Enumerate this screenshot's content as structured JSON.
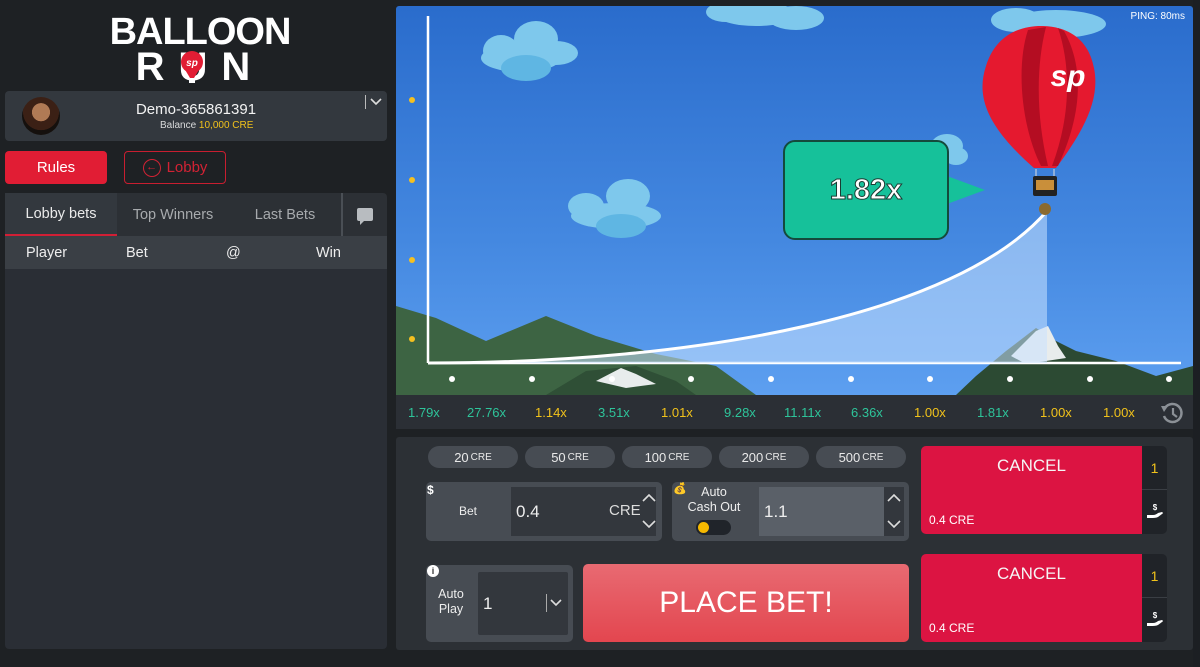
{
  "app": {
    "logo_line1": "BALLOON",
    "logo_line2": "RUN",
    "logo_badge": "sp"
  },
  "user": {
    "name": "Demo-365861391",
    "balance_label": "Balance",
    "balance_value": "10,000 CRE",
    "avatar_icon": "avatar-bearded-man"
  },
  "nav": {
    "rules_label": "Rules",
    "lobby_label": "Lobby",
    "lobby_icon": "arrow-left-circle-icon"
  },
  "sidebar": {
    "tabs": [
      {
        "label": "Lobby bets",
        "active": true
      },
      {
        "label": "Top Winners",
        "active": false
      },
      {
        "label": "Last Bets",
        "active": false
      }
    ],
    "chat_icon": "chat-bubble-icon",
    "columns": [
      "Player",
      "Bet",
      "@",
      "Win"
    ],
    "rows": []
  },
  "game": {
    "ping": "PING: 80ms",
    "multiplier": "1.82x",
    "balloon_logo": "sp"
  },
  "history": {
    "items": [
      {
        "value": "1.79x",
        "color": "#2ec49a"
      },
      {
        "value": "27.76x",
        "color": "#2ec49a"
      },
      {
        "value": "1.14x",
        "color": "#f1c21b"
      },
      {
        "value": "3.51x",
        "color": "#2ec49a"
      },
      {
        "value": "1.01x",
        "color": "#f1c21b"
      },
      {
        "value": "9.28x",
        "color": "#2ec49a"
      },
      {
        "value": "11.11x",
        "color": "#2ec49a"
      },
      {
        "value": "6.36x",
        "color": "#2ec49a"
      },
      {
        "value": "1.00x",
        "color": "#f1c21b"
      },
      {
        "value": "1.81x",
        "color": "#2ec49a"
      },
      {
        "value": "1.00x",
        "color": "#f1c21b"
      },
      {
        "value": "1.00x",
        "color": "#f1c21b"
      }
    ],
    "history_icon": "history-clock-icon"
  },
  "controls": {
    "chips": [
      {
        "amount": "20",
        "unit": "CRE"
      },
      {
        "amount": "50",
        "unit": "CRE"
      },
      {
        "amount": "100",
        "unit": "CRE"
      },
      {
        "amount": "200",
        "unit": "CRE"
      },
      {
        "amount": "500",
        "unit": "CRE"
      }
    ],
    "bet": {
      "icon": "$",
      "label": "Bet",
      "value": "0.4",
      "unit": "CRE"
    },
    "auto_cash_out": {
      "label_line1": "Auto",
      "label_line2": "Cash Out",
      "value": "1.1",
      "enabled": false
    },
    "auto_play": {
      "info_icon": "i",
      "label_line1": "Auto",
      "label_line2": "Play",
      "value": "1"
    },
    "place_bet_label": "PLACE BET!",
    "cancel_cards": [
      {
        "label": "CANCEL",
        "amount": "0.4 CRE",
        "count": "1"
      },
      {
        "label": "CANCEL",
        "amount": "0.4 CRE",
        "count": "1"
      }
    ]
  }
}
